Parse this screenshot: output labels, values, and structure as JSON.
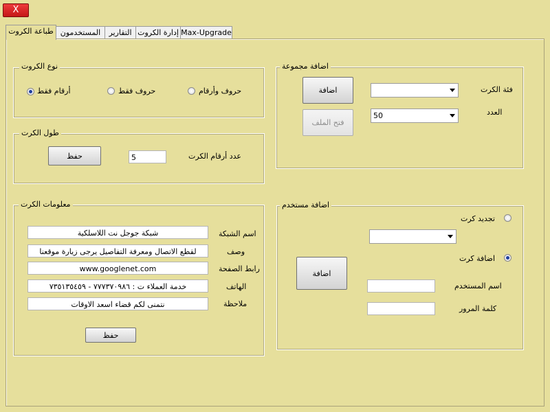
{
  "window": {
    "close_label": "X"
  },
  "tabs": [
    {
      "label": "طباعة الكروت",
      "active": true
    },
    {
      "label": "المستخدمون",
      "active": false
    },
    {
      "label": "التقارير",
      "active": false
    },
    {
      "label": "إدارة الكروت",
      "active": false
    },
    {
      "label": "Max-Upgrade",
      "active": false
    }
  ],
  "card_type": {
    "title": "نوع الكروت",
    "options": [
      {
        "label": "أرقام فقط",
        "checked": true
      },
      {
        "label": "حروف فقط",
        "checked": false
      },
      {
        "label": "حروف وأرقام",
        "checked": false
      }
    ]
  },
  "card_length": {
    "title": "طول الكرت",
    "digits_label": "عدد أرقام الكرت",
    "digits_value": "5",
    "save_label": "حفظ"
  },
  "card_info": {
    "title": "معلومات الكرت",
    "network_label": "اسم الشبكة",
    "network_value": "شبكة جوجل نت اللاسلكية",
    "desc_label": "وصف",
    "desc_value": "لقطع الاتصال ومعرفة التفاصيل يرجى زيارة موقعنا",
    "page_label": "رابط الصفحة",
    "page_value": "www.googlenet.com",
    "phone_label": "الهاتف",
    "phone_value": "خدمة العملاء ت : ٧٧٧٣٧٠٩٨٦ - ٧٣٥١٣٥٤٥٩",
    "note_label": "ملاحظة",
    "note_value": "نتمنى لكم قضاء اسعد الاوقات",
    "save_label": "حفظ"
  },
  "add_group": {
    "title": "اضافة مجموعة",
    "category_label": "فئة الكرت",
    "category_value": "",
    "count_label": "العدد",
    "count_value": "50",
    "add_label": "اضافة",
    "open_file_label": "فتح الملف"
  },
  "add_user": {
    "title": "اضافة مستخدم",
    "renew_label": "تجديد كرت",
    "renew_checked": false,
    "card_value": "",
    "add_card_label": "اضافة كرت",
    "add_card_checked": true,
    "username_label": "اسم المستخدم",
    "username_value": "",
    "password_label": "كلمة المرور",
    "password_value": "",
    "add_label": "اضافة"
  }
}
